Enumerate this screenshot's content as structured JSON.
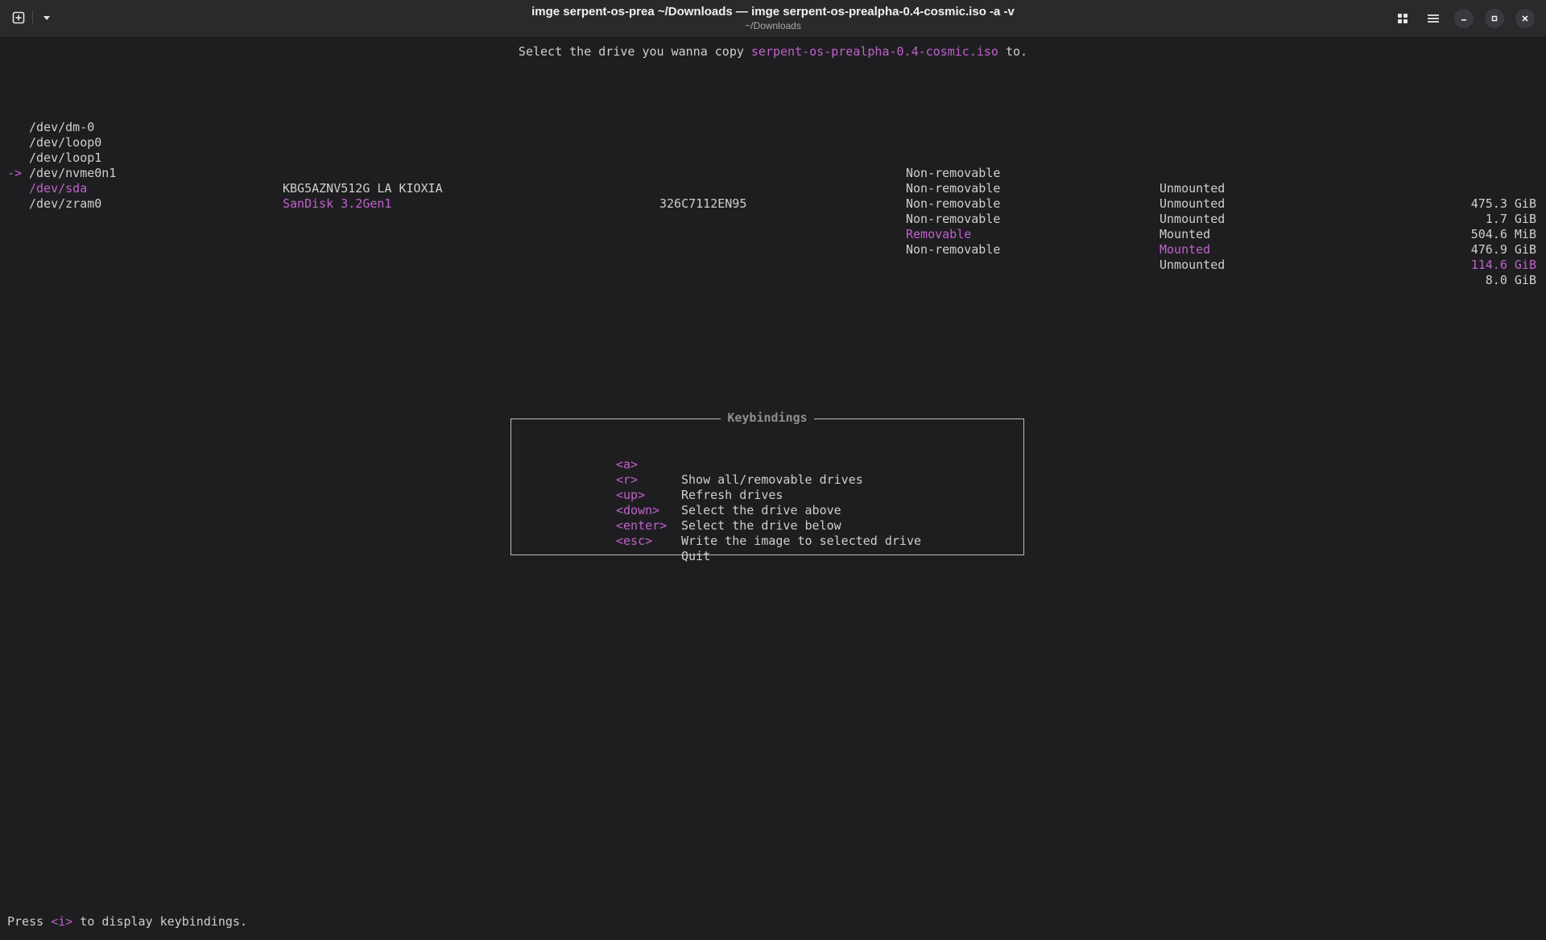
{
  "window": {
    "title": "imge serpent-os-prea ~/Downloads — imge serpent-os-prealpha-0.4-cosmic.iso -a -v",
    "subtitle": "~/Downloads"
  },
  "prompt": {
    "before": "Select the drive you wanna copy ",
    "filename": "serpent-os-prealpha-0.4-cosmic.iso",
    "after": " to."
  },
  "drives": [
    {
      "arrow": "",
      "device": "/dev/dm-0",
      "model": "",
      "serial": "",
      "removable": "Non-removable",
      "mount": "Unmounted",
      "size": "475.3 GiB"
    },
    {
      "arrow": "",
      "device": "/dev/loop0",
      "model": "",
      "serial": "",
      "removable": "Non-removable",
      "mount": "Unmounted",
      "size": "1.7 GiB"
    },
    {
      "arrow": "",
      "device": "/dev/loop1",
      "model": "",
      "serial": "",
      "removable": "Non-removable",
      "mount": "Unmounted",
      "size": "504.6 MiB"
    },
    {
      "arrow": "",
      "device": "/dev/nvme0n1",
      "model": "KBG5AZNV512G LA KIOXIA",
      "serial": "326C7112EN95",
      "removable": "Non-removable",
      "mount": "Mounted",
      "size": "476.9 GiB"
    },
    {
      "arrow": "->",
      "device": "/dev/sda",
      "model": "SanDisk 3.2Gen1",
      "serial": "",
      "removable": "Removable",
      "mount": "Mounted",
      "size": "114.6 GiB"
    },
    {
      "arrow": "",
      "device": "/dev/zram0",
      "model": "",
      "serial": "",
      "removable": "Non-removable",
      "mount": "Unmounted",
      "size": "8.0 GiB"
    }
  ],
  "keybindings": {
    "title": "Keybindings",
    "items": [
      {
        "key": "<a>",
        "desc": "Show all/removable drives"
      },
      {
        "key": "<r>",
        "desc": "Refresh drives"
      },
      {
        "key": "<up>",
        "desc": "Select the drive above"
      },
      {
        "key": "<down>",
        "desc": "Select the drive below"
      },
      {
        "key": "<enter>",
        "desc": "Write the image to selected drive"
      },
      {
        "key": "<esc>",
        "desc": "Quit"
      }
    ]
  },
  "footer": {
    "before": "Press ",
    "key": "<i>",
    "after": " to display keybindings."
  },
  "icons": {
    "new_tab": "new-tab-icon",
    "dropdown": "chevron-down-icon",
    "tab_overview": "grid-icon",
    "menu": "hamburger-menu-icon",
    "minimize": "minimize-icon",
    "maximize": "maximize-icon",
    "close": "close-icon"
  },
  "colors": {
    "background": "#1e1e21",
    "accent": "#c061cb",
    "text": "#cfcfcf"
  }
}
